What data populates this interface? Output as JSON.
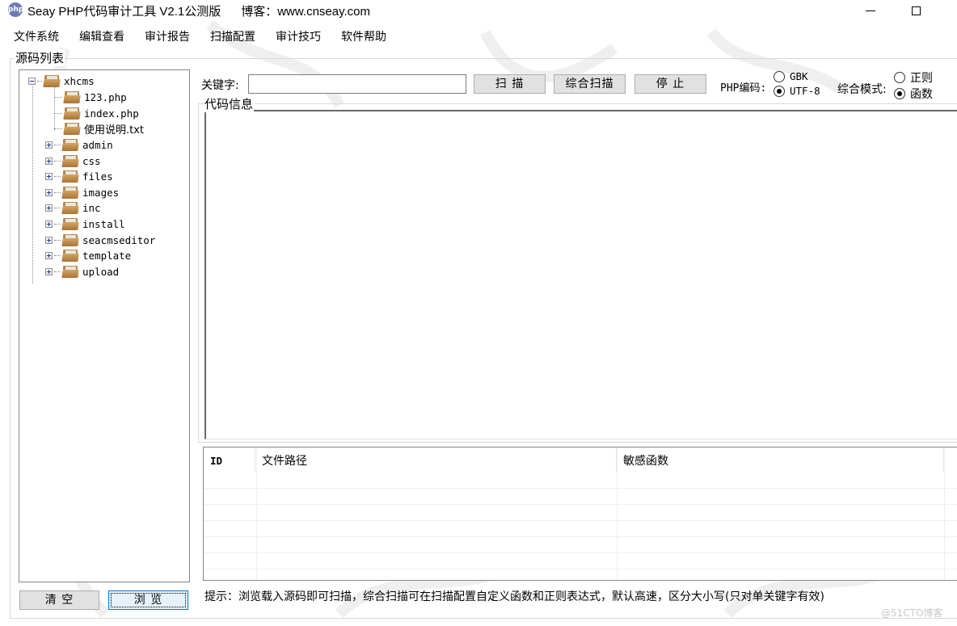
{
  "window": {
    "title": "Seay PHP代码审计工具 V2.1公测版      博客：www.cnseay.com",
    "app_icon_text": "php",
    "minimize_icon": "minimize-icon",
    "maximize_icon": "maximize-icon"
  },
  "menu": [
    {
      "label": "文件系统"
    },
    {
      "label": "编辑查看"
    },
    {
      "label": "审计报告"
    },
    {
      "label": "扫描配置"
    },
    {
      "label": "审计技巧"
    },
    {
      "label": "软件帮助"
    }
  ],
  "source_panel": {
    "group_label": "源码列表",
    "tree": {
      "root": {
        "label": "xhcms",
        "expanded": true,
        "icon": "folder-icon"
      },
      "children": [
        {
          "label": "123.php",
          "type": "file",
          "icon": "folder-icon"
        },
        {
          "label": "index.php",
          "type": "file",
          "icon": "folder-icon"
        },
        {
          "label": "使用说明.txt",
          "type": "file",
          "icon": "folder-icon"
        },
        {
          "label": "admin",
          "type": "folder",
          "expanded": false
        },
        {
          "label": "css",
          "type": "folder",
          "expanded": false
        },
        {
          "label": "files",
          "type": "folder",
          "expanded": false
        },
        {
          "label": "images",
          "type": "folder",
          "expanded": false
        },
        {
          "label": "inc",
          "type": "folder",
          "expanded": false
        },
        {
          "label": "install",
          "type": "folder",
          "expanded": false
        },
        {
          "label": "seacmseditor",
          "type": "folder",
          "expanded": false
        },
        {
          "label": "template",
          "type": "folder",
          "expanded": false
        },
        {
          "label": "upload",
          "type": "folder",
          "expanded": false
        }
      ]
    },
    "clear_button": "清 空",
    "browse_button": "浏 览"
  },
  "toolbar": {
    "keyword_label": "关键字:",
    "keyword_value": "",
    "scan_button": "扫 描",
    "full_scan_button": "综合扫描",
    "stop_button": "停 止",
    "encoding_label": "PHP编码:",
    "encoding_options": [
      {
        "label": "GBK",
        "checked": false
      },
      {
        "label": "UTF-8",
        "checked": true
      }
    ],
    "mode_label": "综合模式:",
    "mode_options": [
      {
        "label": "正则",
        "checked": false
      },
      {
        "label": "函数",
        "checked": true
      }
    ]
  },
  "code_info": {
    "group_label": "代码信息",
    "content": ""
  },
  "results_table": {
    "columns": [
      "ID",
      "文件路径",
      "敏感函数"
    ],
    "rows": []
  },
  "status": {
    "hint": "提示：浏览载入源码即可扫描，综合扫描可在扫描配置自定义函数和正则表达式，默认高速，区分大小写(只对单关键字有效)"
  },
  "watermark": "@51CTO博客"
}
